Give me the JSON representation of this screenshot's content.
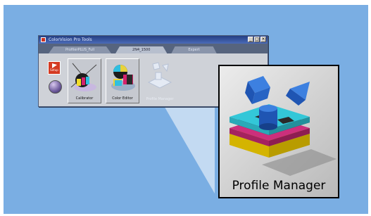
{
  "window": {
    "title": "ColorVision Pro Tools",
    "tabs": [
      {
        "label": "ProfilerPLUS_Full",
        "active": false
      },
      {
        "label": "2N4_1500",
        "active": true
      },
      {
        "label": "Expert",
        "active": false
      }
    ],
    "controls": [
      "_",
      "□",
      "×"
    ]
  },
  "toolbar": {
    "flag_label": "Setup",
    "tools": [
      {
        "label": "Calibrator",
        "enabled": true
      },
      {
        "label": "Color Editor",
        "enabled": true
      },
      {
        "label": "Profile Manager",
        "enabled": false
      }
    ]
  },
  "callout": {
    "label": "Profile Manager"
  },
  "colors": {
    "background": "#7aaee3",
    "titlebar": "#253f83",
    "window_body": "#cfd2d8",
    "cube_blue": "#2f6fd0",
    "stack_cyan": "#33c7d8",
    "stack_magenta": "#cc2f7c",
    "stack_yellow": "#e5c800"
  }
}
